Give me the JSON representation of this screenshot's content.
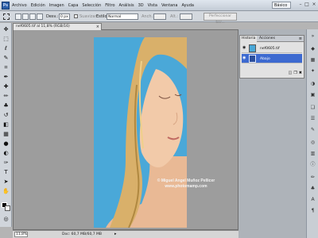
{
  "app": {
    "logo": "Ps",
    "menu": [
      "Archivo",
      "Edición",
      "Imagen",
      "Capa",
      "Selección",
      "Filtro",
      "Análisis",
      "3D",
      "Vista",
      "Ventana",
      "Ayuda"
    ],
    "zoom_level": "11,8",
    "workspace": "Básico"
  },
  "options": {
    "feather_label": "Desv.:",
    "feather_value": "0 px",
    "antialias_label": "Suavizar",
    "style_label": "Estilo:",
    "style_value": "Normal",
    "width_label": "Anch.:",
    "height_label": "Alt.:",
    "refine_button": "Perfeccionar bor..."
  },
  "document": {
    "tab_title": "nef0605.tif al 11,8% (RGB/16)",
    "watermark_line1": "© Miguel Angel Muñoz Pellicer",
    "watermark_line2": "www.photomamp.com",
    "background_color": "#4aa8d8"
  },
  "status": {
    "zoom": "11,8%",
    "doc_info": "Doc: 60,7 MB/60,7 MB"
  },
  "layers_panel": {
    "tabs": [
      "Historia",
      "Acciones"
    ],
    "layers": [
      {
        "name": "nef0605.tif",
        "selected": false
      },
      {
        "name": "Abajo",
        "selected": true
      }
    ]
  },
  "colors": {
    "selection": "#3d6ad0",
    "foreground": "#000000",
    "background": "#ffffff"
  }
}
